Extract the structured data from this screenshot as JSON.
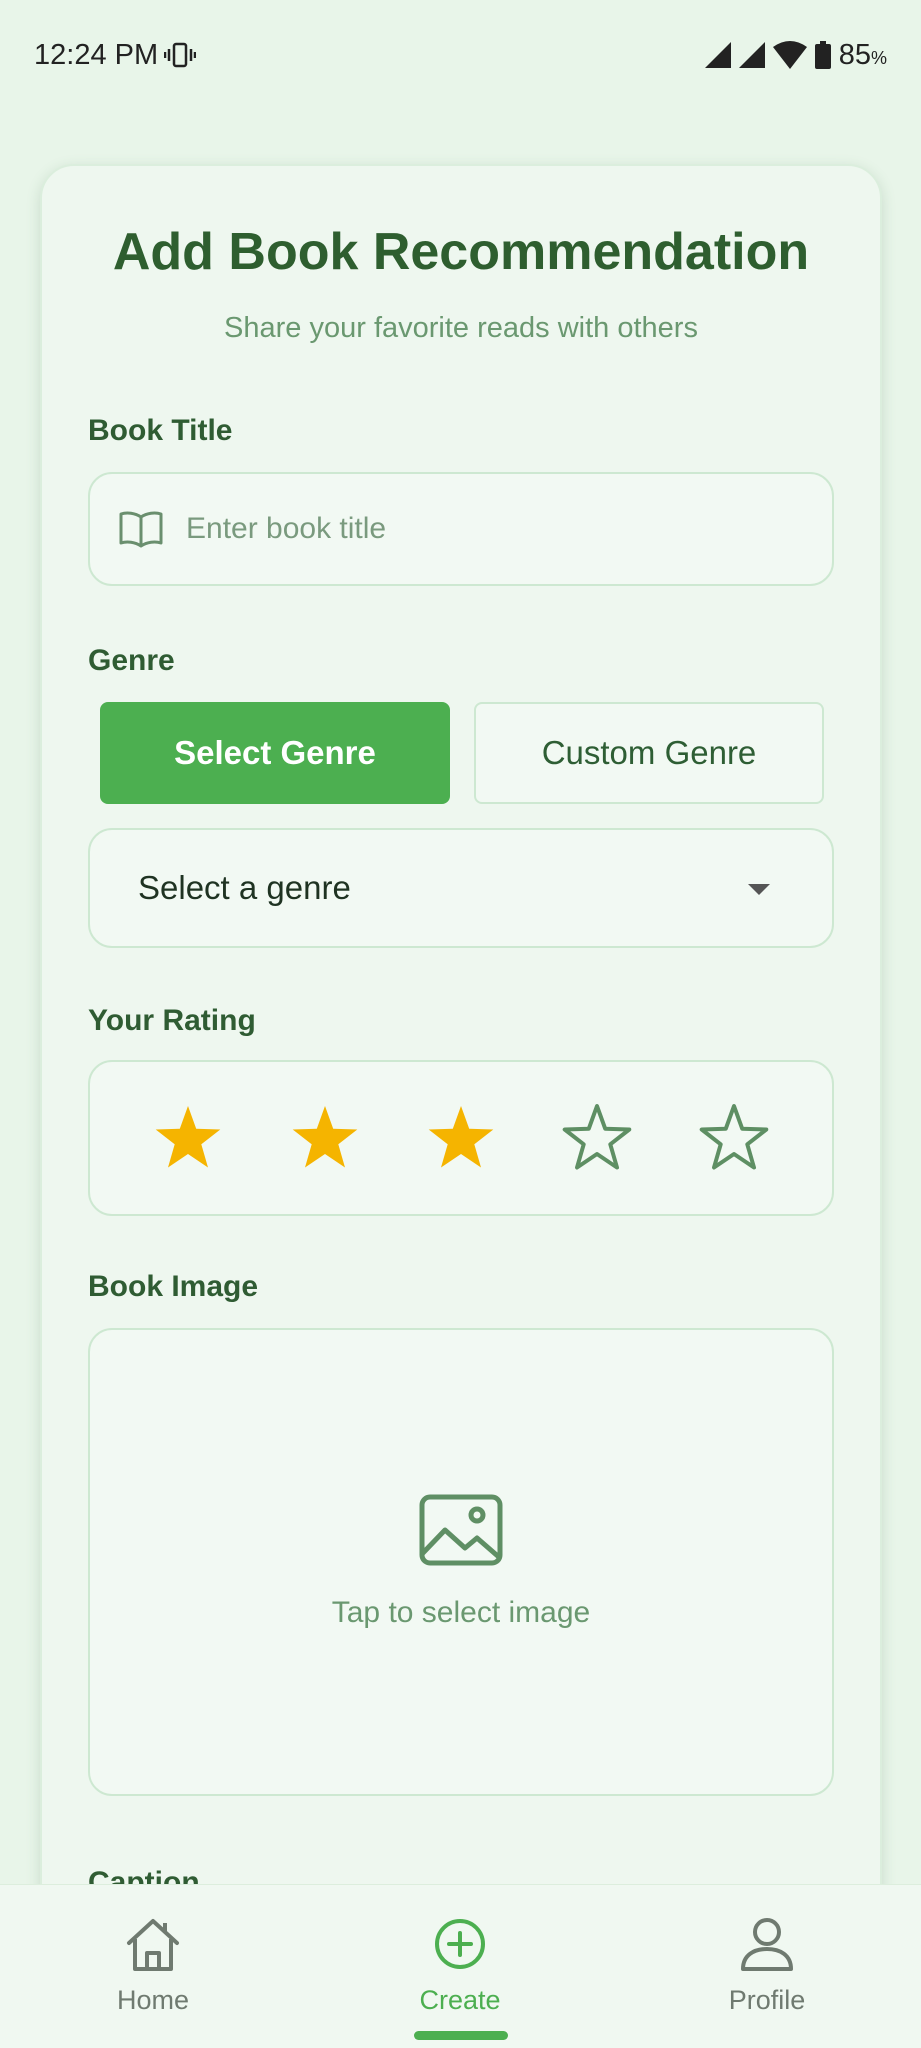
{
  "status_bar": {
    "time": "12:24 PM",
    "battery": "85",
    "battery_suffix": "%"
  },
  "form": {
    "title": "Add Book Recommendation",
    "subtitle": "Share your favorite reads with others",
    "book_title": {
      "label": "Book Title",
      "placeholder": "Enter book title",
      "icon": "book-icon"
    },
    "genre": {
      "label": "Genre",
      "mode_buttons": [
        "Select Genre",
        "Custom Genre"
      ],
      "selected_mode": "Select Genre",
      "dropdown_value": "Select a genre"
    },
    "rating": {
      "label": "Your Rating",
      "value": 3,
      "max": 5,
      "filled_color": "#F5B400",
      "empty_color": "#5E8F63"
    },
    "image": {
      "label": "Book Image",
      "hint": "Tap to select image",
      "icon": "image-icon"
    },
    "caption": {
      "label": "Caption"
    }
  },
  "bottom_nav": {
    "items": [
      {
        "label": "Home",
        "icon": "home-icon",
        "active": false
      },
      {
        "label": "Create",
        "icon": "plus-circle-icon",
        "active": true
      },
      {
        "label": "Profile",
        "icon": "user-icon",
        "active": false
      }
    ]
  },
  "colors": {
    "accent": "#4CAF50",
    "background": "#E8F5E9",
    "heading": "#2E5E2F"
  }
}
